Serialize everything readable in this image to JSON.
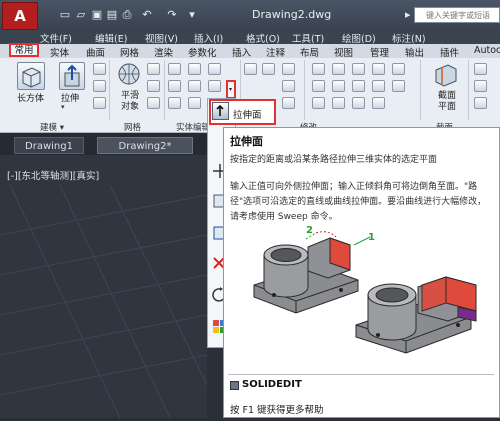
{
  "window": {
    "doc_title": "Drawing2.dwg",
    "search_placeholder": "键入关键字或短语",
    "app_button": "A"
  },
  "quick_access": [
    "new-icon",
    "open-icon",
    "save-icon",
    "saveas-icon",
    "print-icon",
    "undo-icon",
    "redo-icon"
  ],
  "menubar": [
    "文件(F)",
    "编辑(E)",
    "视图(V)",
    "插入(I)",
    "格式(O)",
    "工具(T)",
    "绘图(D)",
    "标注(N)"
  ],
  "ribbon_tabs": [
    "常用",
    "实体",
    "曲面",
    "网格",
    "渲染",
    "参数化",
    "插入",
    "注释",
    "布局",
    "视图",
    "管理",
    "输出",
    "插件",
    "Autoc"
  ],
  "active_tab": "常用",
  "ribbon": {
    "box_label": "长方体",
    "extrude_label": "拉伸",
    "smooth_label": "平滑\n对象",
    "section_label": "截面\n平面",
    "panels": [
      "建模 ▾",
      "网格",
      "实体编辑",
      "修改",
      "截面"
    ]
  },
  "flyout": {
    "extrude_face_label": "拉伸面"
  },
  "doc_tabs": [
    "Drawing1",
    "Drawing2*"
  ],
  "viewport_label": "[-][东北等轴测][真实]",
  "tooltip": {
    "title": "拉伸面",
    "description": "按指定的距离或沿某条路径拉伸三维实体的选定平面",
    "detail": "输入正值可向外侧拉伸面；输入正倾斜角可将边倒角至面。\"路径\"选项可沿选定的直线或曲线拉伸面。要沿曲线进行大幅修改，请考虑使用 Sweep 命令。",
    "callout_1": "1",
    "callout_2": "2",
    "command": "SOLIDEDIT",
    "help": "按 F1 键获得更多帮助"
  },
  "colors": {
    "highlight": "#e53030",
    "face_red": "#e04a3c",
    "face_purple": "#7a2a8a",
    "callout_green": "#2aa02a"
  }
}
